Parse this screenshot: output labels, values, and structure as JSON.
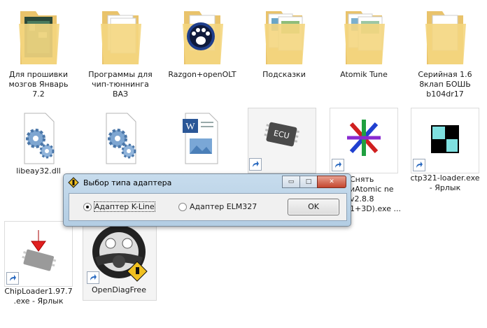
{
  "desktop": {
    "items": [
      {
        "label": "Для прошивки мозгов Январь 7.2",
        "icon": "folder-icon"
      },
      {
        "label": "Программы для чип-тюннинга ВАЗ",
        "icon": "folder-icon"
      },
      {
        "label": "Razgon+openOLT",
        "icon": "folder-icon"
      },
      {
        "label": "Подсказки",
        "icon": "folder-icon"
      },
      {
        "label": "Atomik Tune",
        "icon": "folder-icon"
      },
      {
        "label": "Серийная 1.6 8клап БОШЬ b104dr17",
        "icon": "folder-icon"
      },
      {
        "label": "libeay32.dll",
        "icon": "dll-gear-icon"
      },
      {
        "label": "",
        "icon": "dll-gear-icon"
      },
      {
        "label": "",
        "icon": "word-document-icon"
      },
      {
        "label": "",
        "icon": "ecu-chip-icon"
      },
      {
        "label_right": "Снять иAtomic ne v2.8.8 1+3D).exe ...",
        "icon": "atomic-star-icon"
      },
      {
        "label": "ctp321-loader.exe - Ярлык",
        "icon": "ctp-loader-icon"
      },
      {
        "label": "ChipLoader1.97.7.exe - Ярлык",
        "icon": "chiploader-icon"
      },
      {
        "label": "OpenDiagFree",
        "icon": "steering-wheel-icon"
      }
    ]
  },
  "dialog": {
    "title": "Выбор типа адаптера",
    "radio_kline": "Адаптер K-Line",
    "radio_elm": "Адаптер ELM327",
    "ok": "OK",
    "minimize": "▭",
    "maximize": "□",
    "close": "✕"
  }
}
